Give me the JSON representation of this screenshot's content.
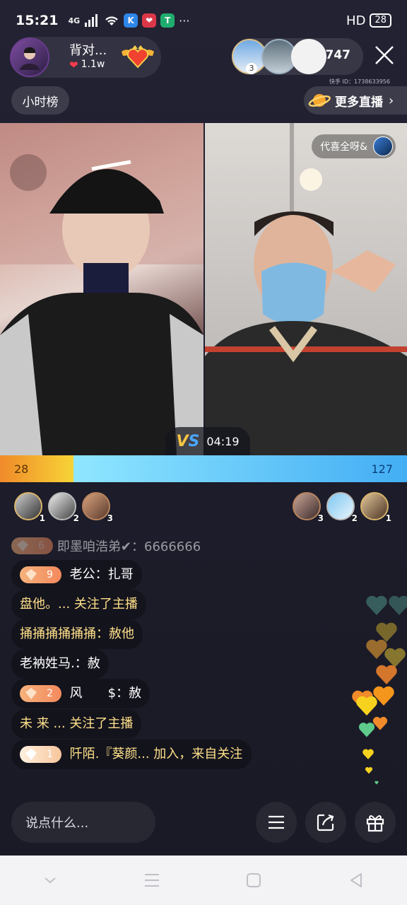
{
  "status": {
    "time": "15:21",
    "network": "4G",
    "apps": [
      "K",
      "❤",
      "T"
    ],
    "more": "···",
    "hd": "HD",
    "battery": "28"
  },
  "host": {
    "name": "背对...",
    "likes": "1.1w"
  },
  "viewers": {
    "count": "747",
    "badge_rank": "3",
    "kuaishou_id": "快手 ID：1738633956"
  },
  "nav": {
    "hour_rank": "小时榜",
    "more_live": "更多直播"
  },
  "guest": {
    "name": "代喜全呀&"
  },
  "pk": {
    "timer": "04:19",
    "left_score": "28",
    "right_score": "127",
    "left_share": 0.18
  },
  "contributors": {
    "left_ranks": [
      "1",
      "2",
      "3"
    ],
    "right_ranks": [
      "3",
      "2",
      "1"
    ]
  },
  "chat": {
    "faded": {
      "level": "6",
      "text": "即墨咱浩弟✔：6666666"
    },
    "items": [
      {
        "level": "9",
        "name": "老公",
        "sep": "：",
        "msg": "扎哥"
      },
      {
        "level": "",
        "name": "盘他。...",
        "sep": " ",
        "msg": "关注了主播",
        "follow": true
      },
      {
        "level": "",
        "name": "捅捅捅捅捅捅",
        "sep": "：",
        "msg": "赦他"
      },
      {
        "level": "",
        "name": "老衲姓马.",
        "sep": "：",
        "msg": "赦"
      },
      {
        "level": "2",
        "name": "风　　$",
        "sep": "：",
        "msg": "赦"
      },
      {
        "level": "",
        "name": "未 来 ...",
        "sep": " ",
        "msg": "关注了主播",
        "follow": true
      },
      {
        "level": "1",
        "name": "阡陌.『葵颜...",
        "sep": " ",
        "msg": "加入，来自关注"
      }
    ]
  },
  "input": {
    "placeholder": "说点什么..."
  },
  "icons": {
    "menu": "menu-icon",
    "share": "share-icon",
    "gift": "gift-icon",
    "close": "close-icon",
    "planet": "planet-icon"
  },
  "colors": {
    "pk_left": "#f7d436",
    "pk_right": "#43aef4",
    "level_badge": "#f3895c"
  }
}
